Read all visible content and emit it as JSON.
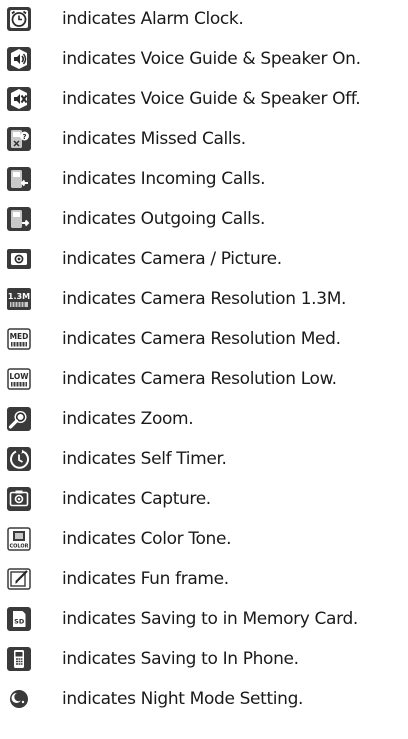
{
  "legend": {
    "items": [
      {
        "icon": "alarm-clock-icon",
        "text": "indicates Alarm Clock."
      },
      {
        "icon": "voice-guide-speaker-on-icon",
        "text": "indicates Voice Guide & Speaker On."
      },
      {
        "icon": "voice-guide-speaker-off-icon",
        "text": "indicates Voice Guide & Speaker Off."
      },
      {
        "icon": "missed-calls-icon",
        "text": "indicates Missed Calls."
      },
      {
        "icon": "incoming-calls-icon",
        "text": "indicates Incoming Calls."
      },
      {
        "icon": "outgoing-calls-icon",
        "text": "indicates Outgoing Calls."
      },
      {
        "icon": "camera-picture-icon",
        "text": "indicates Camera / Picture."
      },
      {
        "icon": "camera-resolution-1-3m-icon",
        "text": "indicates Camera Resolution 1.3M."
      },
      {
        "icon": "camera-resolution-med-icon",
        "text": "indicates Camera Resolution Med."
      },
      {
        "icon": "camera-resolution-low-icon",
        "text": "indicates Camera Resolution Low."
      },
      {
        "icon": "zoom-icon",
        "text": "indicates Zoom."
      },
      {
        "icon": "self-timer-icon",
        "text": "indicates Self Timer."
      },
      {
        "icon": "capture-icon",
        "text": "indicates Capture."
      },
      {
        "icon": "color-tone-icon",
        "text": "indicates Color Tone."
      },
      {
        "icon": "fun-frame-icon",
        "text": "indicates Fun frame."
      },
      {
        "icon": "memory-card-icon",
        "text": "indicates Saving to in Memory Card."
      },
      {
        "icon": "phone-memory-icon",
        "text": "indicates Saving to In Phone."
      },
      {
        "icon": "night-mode-icon",
        "text": "indicates Night Mode Setting."
      }
    ],
    "icon_colors": {
      "tile_dark": "#3a3a3a",
      "tile_light": "#c8c8c8",
      "outline": "#2a2a2a",
      "white": "#ffffff",
      "text": "#1a1a1a"
    },
    "icon_labels": {
      "resolution_high": "1.3M",
      "resolution_med": "MED",
      "resolution_low": "LOW",
      "memory_card": "SD",
      "color_tone": "COLOR"
    }
  }
}
